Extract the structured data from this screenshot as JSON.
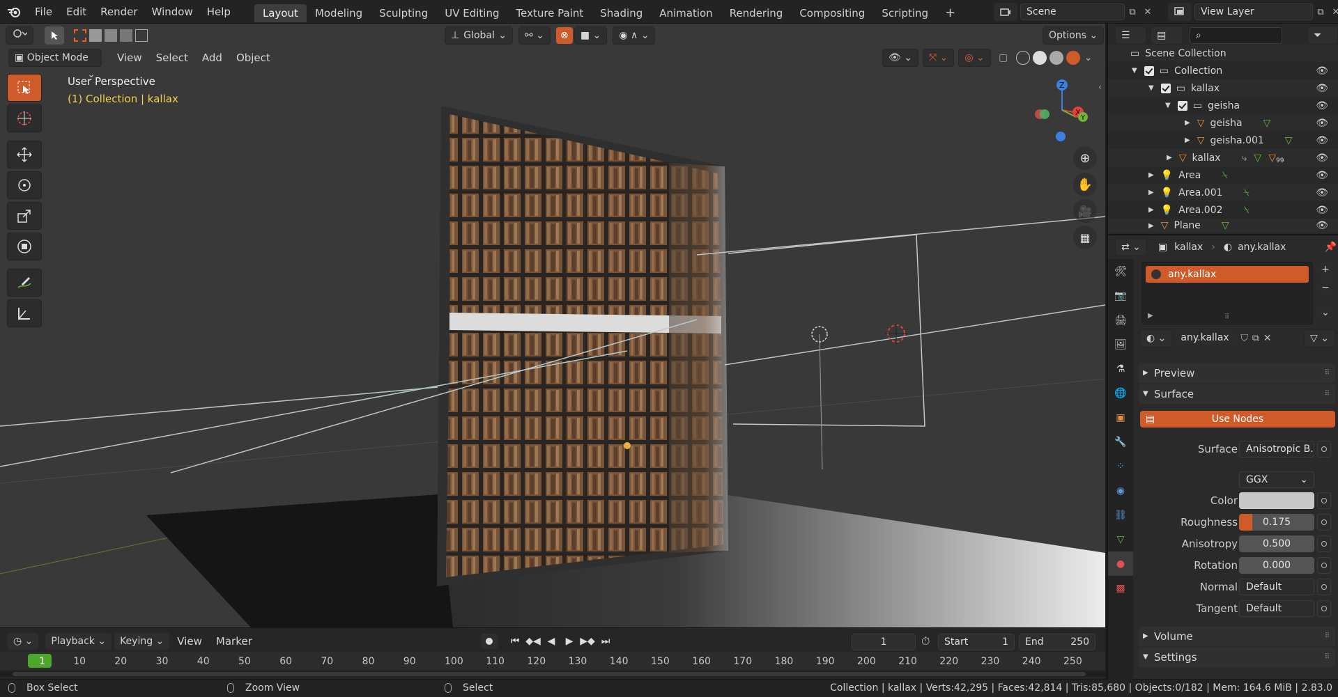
{
  "topbar": {
    "menus": [
      "File",
      "Edit",
      "Render",
      "Window",
      "Help"
    ],
    "workspaces": [
      "Layout",
      "Modeling",
      "Sculpting",
      "UV Editing",
      "Texture Paint",
      "Shading",
      "Animation",
      "Rendering",
      "Compositing",
      "Scripting"
    ],
    "active_workspace": "Layout",
    "add_tab": "+",
    "scene_label": "Scene",
    "view_layer_label": "View Layer"
  },
  "viewport": {
    "mode": "Object Mode",
    "menus": [
      "View",
      "Select",
      "Add",
      "Object"
    ],
    "transform_orientation": "Global",
    "options_label": "Options",
    "overlay_title": "User Perspective",
    "overlay_subtitle": "(1) Collection | kallax",
    "gizmo_axes": {
      "z": "Z",
      "x": "X",
      "y": "Y"
    }
  },
  "outliner": {
    "search_placeholder": "",
    "rows": [
      {
        "label": "Scene Collection"
      },
      {
        "label": "Collection"
      },
      {
        "label": "kallax"
      },
      {
        "label": "geisha"
      },
      {
        "label": "geisha"
      },
      {
        "label": "geisha.001"
      },
      {
        "label": "kallax",
        "badge": "99"
      },
      {
        "label": "Area"
      },
      {
        "label": "Area.001"
      },
      {
        "label": "Area.002"
      },
      {
        "label": "Plane"
      }
    ]
  },
  "properties": {
    "breadcrumb_object": "kallax",
    "breadcrumb_material": "any.kallax",
    "material_slot": "any.kallax",
    "material_name": "any.kallax",
    "panels": {
      "preview": "Preview",
      "surface": "Surface",
      "volume": "Volume",
      "settings": "Settings"
    },
    "use_nodes_label": "Use Nodes",
    "surface_label": "Surface",
    "surface_value": "Anisotropic B...",
    "distribution_value": "GGX",
    "color_label": "Color",
    "color_hex": "#c8c8c8",
    "roughness_label": "Roughness",
    "roughness_value": "0.175",
    "anisotropy_label": "Anisotropy",
    "anisotropy_value": "0.500",
    "rotation_label": "Rotation",
    "rotation_value": "0.000",
    "normal_label": "Normal",
    "normal_value": "Default",
    "tangent_label": "Tangent",
    "tangent_value": "Default"
  },
  "timeline": {
    "menus": [
      "Playback",
      "Keying",
      "View",
      "Marker"
    ],
    "current_frame": "1",
    "start_label": "Start",
    "start_value": "1",
    "end_label": "End",
    "end_value": "250",
    "ticks": [
      "1",
      "10",
      "20",
      "30",
      "40",
      "50",
      "60",
      "70",
      "80",
      "90",
      "100",
      "110",
      "120",
      "130",
      "140",
      "150",
      "160",
      "170",
      "180",
      "190",
      "200",
      "210",
      "220",
      "230",
      "240",
      "250"
    ]
  },
  "statusbar": {
    "left_hint": "Box Select",
    "middle_hint": "Zoom View",
    "right_hint": "Select",
    "stats": "Collection | kallax | Verts:42,295 | Faces:42,814 | Tris:85,680 | Objects:0/182 | Mem: 164.6 MiB | 2.83.0"
  },
  "colors": {
    "accent": "#cf5a2a",
    "overlay_subtitle": "#f3d04a",
    "axis_x": "#e0413f",
    "axis_y": "#6fb63b",
    "axis_z": "#3b7fe0"
  }
}
